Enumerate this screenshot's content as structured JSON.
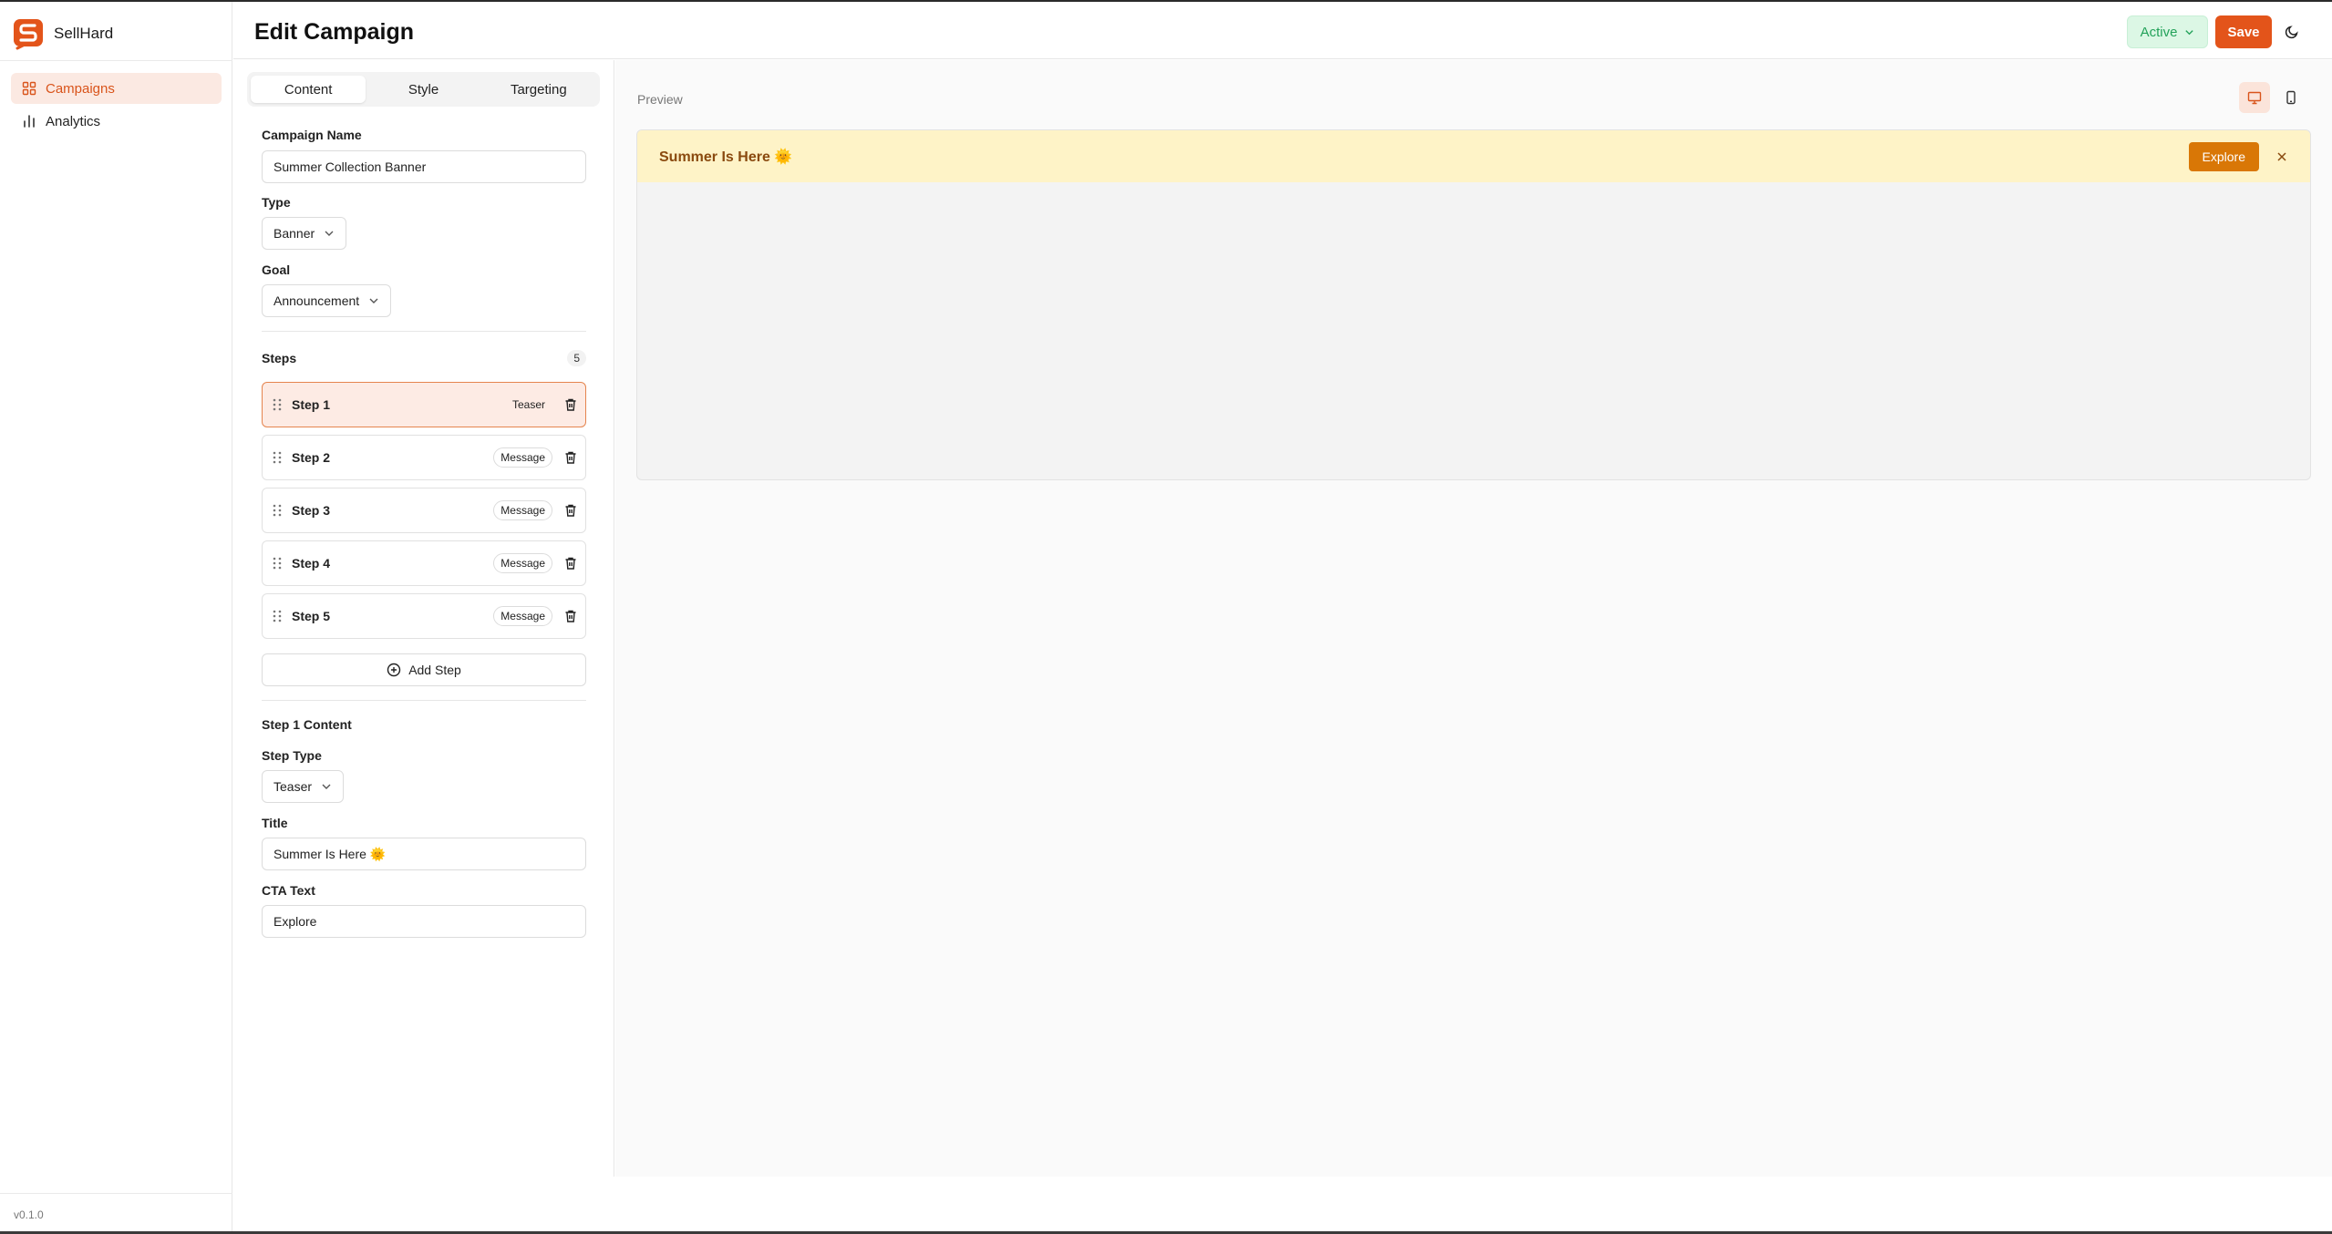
{
  "app": {
    "name": "SellHard",
    "version": "v0.1.0"
  },
  "sidebar": {
    "items": [
      {
        "label": "Campaigns",
        "icon": "grid-icon",
        "active": true
      },
      {
        "label": "Analytics",
        "icon": "bar-chart-icon",
        "active": false
      }
    ]
  },
  "header": {
    "title": "Edit Campaign",
    "status": "Active",
    "save_label": "Save"
  },
  "editor": {
    "tabs": [
      "Content",
      "Style",
      "Targeting"
    ],
    "active_tab": "Content",
    "campaign_name_label": "Campaign Name",
    "campaign_name_value": "Summer Collection Banner",
    "type_label": "Type",
    "type_value": "Banner",
    "goal_label": "Goal",
    "goal_value": "Announcement",
    "steps_label": "Steps",
    "steps_count": "5",
    "steps": [
      {
        "name": "Step 1",
        "type": "Teaser",
        "selected": true
      },
      {
        "name": "Step 2",
        "type": "Message",
        "selected": false
      },
      {
        "name": "Step 3",
        "type": "Message",
        "selected": false
      },
      {
        "name": "Step 4",
        "type": "Message",
        "selected": false
      },
      {
        "name": "Step 5",
        "type": "Message",
        "selected": false
      }
    ],
    "add_step_label": "Add Step",
    "step_content_title": "Step 1 Content",
    "step_type_label": "Step Type",
    "step_type_value": "Teaser",
    "title_label": "Title",
    "title_value": "Summer Is Here 🌞",
    "cta_label": "CTA Text",
    "cta_value": "Explore"
  },
  "preview": {
    "label": "Preview",
    "banner_title": "Summer Is Here 🌞",
    "banner_cta": "Explore"
  },
  "colors": {
    "accent": "#e3541a",
    "status_bg": "#dcf7e5",
    "status_text": "#23a25a",
    "banner_bg": "#fef3c7",
    "banner_cta": "#d97706"
  }
}
